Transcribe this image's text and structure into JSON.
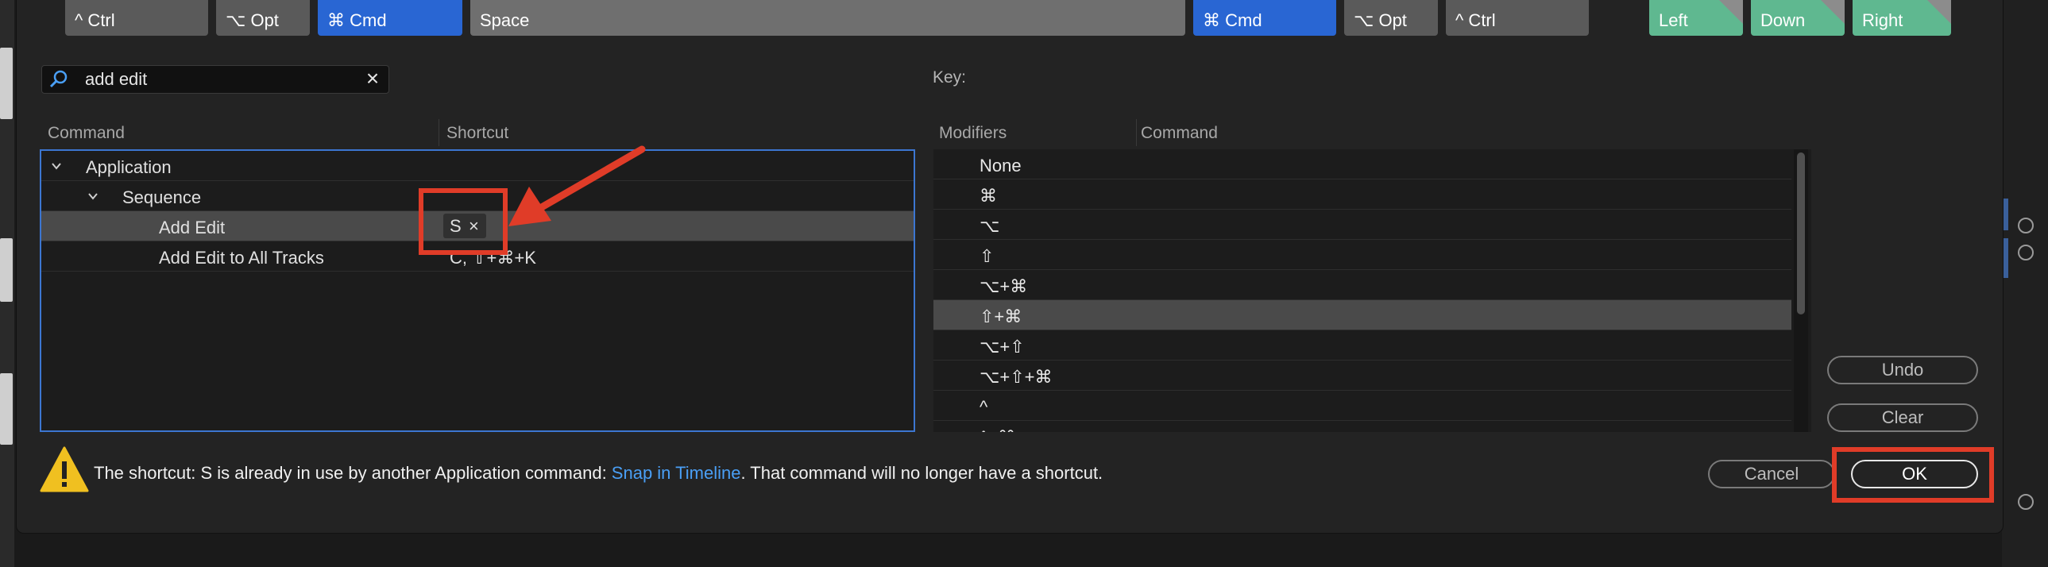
{
  "keyboard": {
    "keys": [
      {
        "label": "^ Ctrl",
        "style": "mod"
      },
      {
        "label": "⌥ Opt",
        "style": "mod"
      },
      {
        "label": "⌘ Cmd",
        "style": "cmd"
      },
      {
        "label": "Space",
        "style": "space"
      },
      {
        "label": "⌘ Cmd",
        "style": "cmd"
      },
      {
        "label": "⌥ Opt",
        "style": "mod"
      },
      {
        "label": "^ Ctrl",
        "style": "mod"
      },
      {
        "label": "Left",
        "style": "arrow"
      },
      {
        "label": "Down",
        "style": "arrow"
      },
      {
        "label": "Right",
        "style": "arrow"
      }
    ]
  },
  "search": {
    "value": "add edit",
    "placeholder": ""
  },
  "key_label": "Key:",
  "command_table": {
    "headers": {
      "command": "Command",
      "shortcut": "Shortcut"
    },
    "rows": [
      {
        "label": "Application",
        "level": 0,
        "expanded": true,
        "shortcut": ""
      },
      {
        "label": "Sequence",
        "level": 1,
        "expanded": true,
        "shortcut": ""
      },
      {
        "label": "Add Edit",
        "level": 2,
        "selected": true,
        "shortcut": "S",
        "chip_remove": "×"
      },
      {
        "label": "Add Edit to All Tracks",
        "level": 2,
        "shortcut": "C, ⇧+⌘+K"
      }
    ]
  },
  "modifier_table": {
    "headers": {
      "modifiers": "Modifiers",
      "command": "Command"
    },
    "rows": [
      {
        "modifier": "None"
      },
      {
        "modifier": "⌘"
      },
      {
        "modifier": "⌥"
      },
      {
        "modifier": "⇧"
      },
      {
        "modifier": "⌥+⌘"
      },
      {
        "modifier": "⇧+⌘",
        "selected": true
      },
      {
        "modifier": "⌥+⇧"
      },
      {
        "modifier": "⌥+⇧+⌘"
      },
      {
        "modifier": "^"
      },
      {
        "modifier": "^+⌘"
      }
    ]
  },
  "buttons": {
    "undo": "Undo",
    "clear": "Clear",
    "cancel": "Cancel",
    "ok": "OK"
  },
  "warning": {
    "prefix": "The shortcut: S is already in use by another Application command: ",
    "link": "Snap in Timeline",
    "suffix": ". That command will no longer have a shortcut."
  },
  "colors": {
    "accent": "#2966d3",
    "selection": "#3c76d1",
    "link": "#4a9ff5",
    "annotation": "#e03c28",
    "warning": "#f0c020"
  }
}
